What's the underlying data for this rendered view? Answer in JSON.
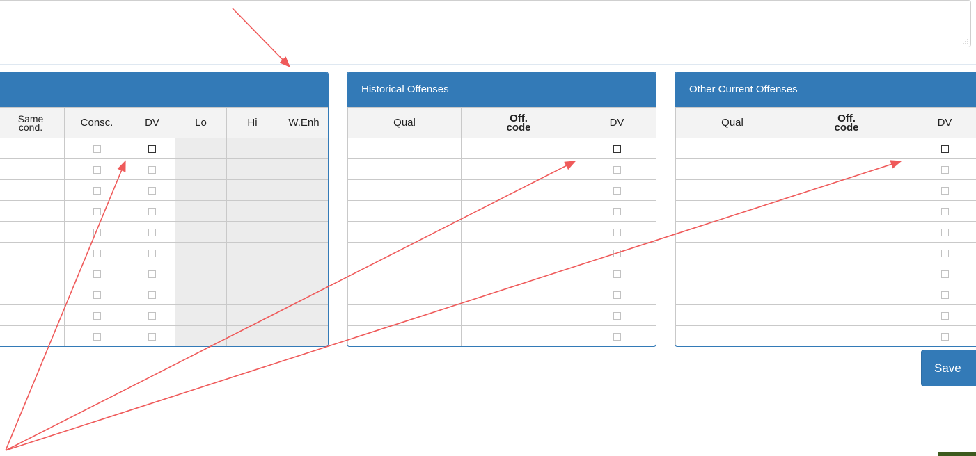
{
  "left_panel": {
    "columns": [
      "Same cond.",
      "Consc.",
      "DV",
      "Lo",
      "Hi",
      "W.Enh"
    ]
  },
  "historical_offenses": {
    "title": "Historical Offenses",
    "columns": [
      "Qual",
      "Off. code",
      "DV"
    ]
  },
  "other_current_offenses": {
    "title": "Other Current Offenses",
    "columns": [
      "Qual",
      "Off. code",
      "DV"
    ]
  },
  "actions": {
    "save_label": "Save"
  },
  "colors": {
    "panel_header": "#337ab7",
    "annotation_arrow": "#ef5a5a"
  }
}
